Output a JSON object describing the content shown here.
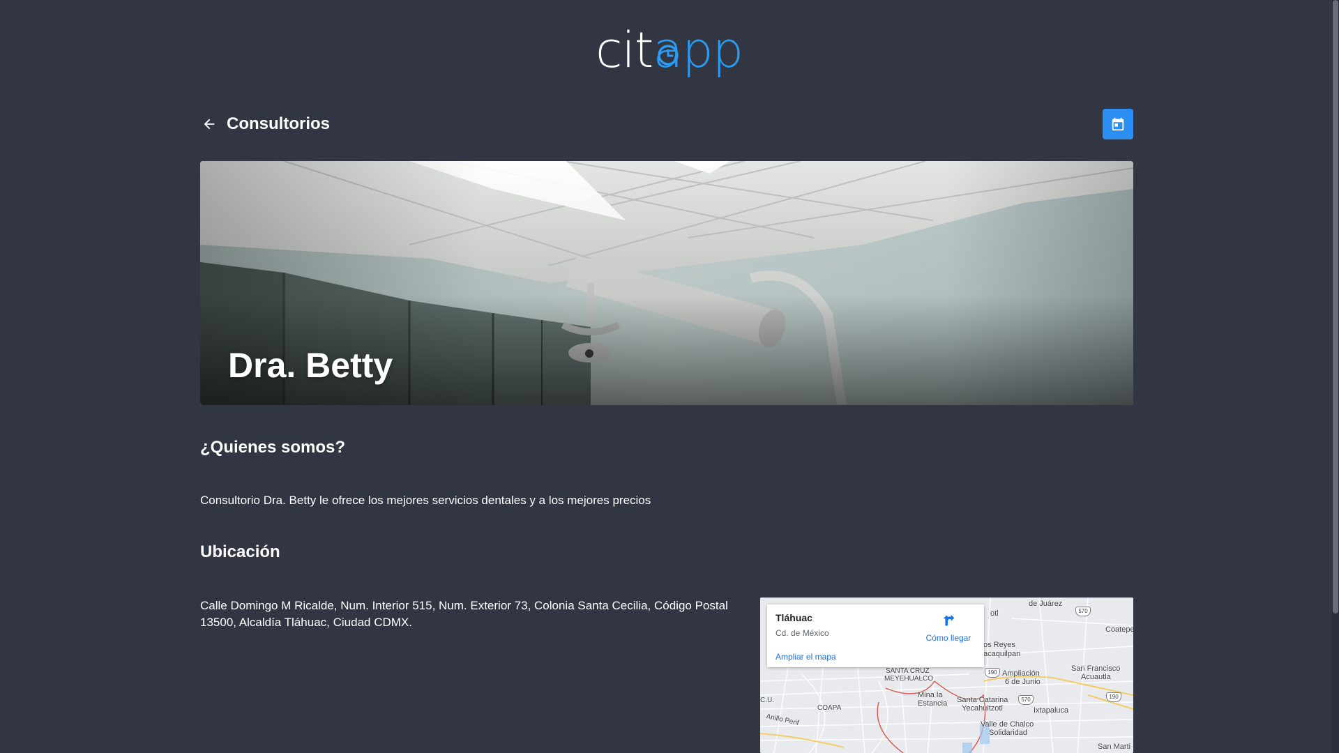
{
  "brand": {
    "logo_prefix": "cit",
    "logo_suffix": "app",
    "accent_color": "#2d9bf0"
  },
  "header": {
    "back_icon": "arrow-left-icon",
    "title": "Consultorios",
    "calendar_icon": "calendar-icon"
  },
  "hero": {
    "title": "Dra. Betty"
  },
  "about": {
    "heading": "¿Quienes somos?",
    "text": "Consultorio Dra. Betty le ofrece los mejores servicios dentales y a los mejores precios"
  },
  "location": {
    "heading": "Ubicación",
    "address": "Calle Domingo M Ricalde, Num. Interior 515, Num. Exterior 73, Colonia Santa Cecilia, Código Postal 13500, Alcaldía Tláhuac, Ciudad CDMX."
  },
  "map": {
    "place_name": "Tláhuac",
    "region": "Cd. de México",
    "directions_label": "Cómo llegar",
    "enlarge_label": "Ampliar el mapa",
    "labels": {
      "de_juarez": "de Juárez",
      "coatepec": "Coatepec",
      "otl": "otl",
      "reyes": "os Reyes",
      "acaquilpan": "acaquilpan",
      "san_francisco": "San Francisco",
      "acuautla": "Acuautla",
      "santa_cruz": "SANTA CRUZ",
      "meyehualco": "MEYEHUALCO",
      "ampliacion": "Ampliación",
      "seis_junio": "6 de Junio",
      "mina": "Mina la",
      "estancia": "Estancia",
      "santa_catarina": "Santa Catarina",
      "yecahuitzotl": "Yecahuitzotl",
      "ixtapaluca": "Ixtapaluca",
      "coapa": "COAPA",
      "cu": "C.U.",
      "anillo": "Anillo Perif",
      "valle_chalco": "Valle de Chalco",
      "solidaridad": "Solidaridad",
      "san_marti": "San Marti",
      "hw_570": "570",
      "hw_190": "190"
    }
  }
}
